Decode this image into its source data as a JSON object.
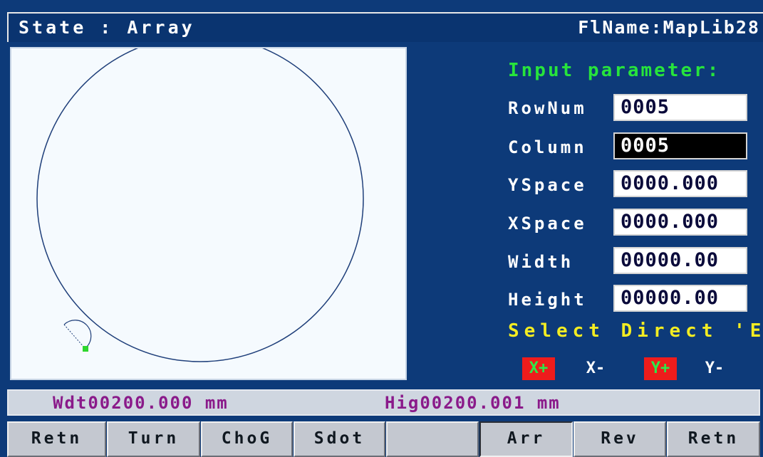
{
  "title": {
    "state": "State : Array",
    "file_name": "FlName:MapLib28"
  },
  "panel": {
    "heading": "Input parameter:",
    "params": [
      {
        "label": "RowNum",
        "value": "0005"
      },
      {
        "label": "Column",
        "value": "0005"
      },
      {
        "label": "YSpace",
        "value": "0000.000"
      },
      {
        "label": "XSpace",
        "value": "0000.000"
      },
      {
        "label": "Width",
        "value": "00000.00"
      },
      {
        "label": "Height",
        "value": "00000.00"
      }
    ],
    "select_prompt": "Select Direct 'En",
    "directions": [
      {
        "label": "X+",
        "selected": true
      },
      {
        "label": "X-",
        "selected": false
      },
      {
        "label": "Y+",
        "selected": true
      },
      {
        "label": "Y-",
        "selected": false
      }
    ]
  },
  "status": {
    "width_label": "Wdt",
    "width_value": "00200.000",
    "width_unit": "mm",
    "height_label": "Hig",
    "height_value": "00200.001",
    "height_unit": "mm"
  },
  "buttons": [
    "Retn",
    "Turn",
    "ChoG",
    "Sdot",
    "",
    "Arr",
    "Rev",
    "Retn"
  ],
  "colors": {
    "background": "#0d3a79",
    "canvas": "#f5fafe",
    "heading": "#27e43c",
    "prompt": "#f2ec22",
    "status_text": "#8a1a8a",
    "direction_on": "#ee1c1c",
    "shape_stroke": "#1f3f7a",
    "start_point": "#2ed62e"
  }
}
